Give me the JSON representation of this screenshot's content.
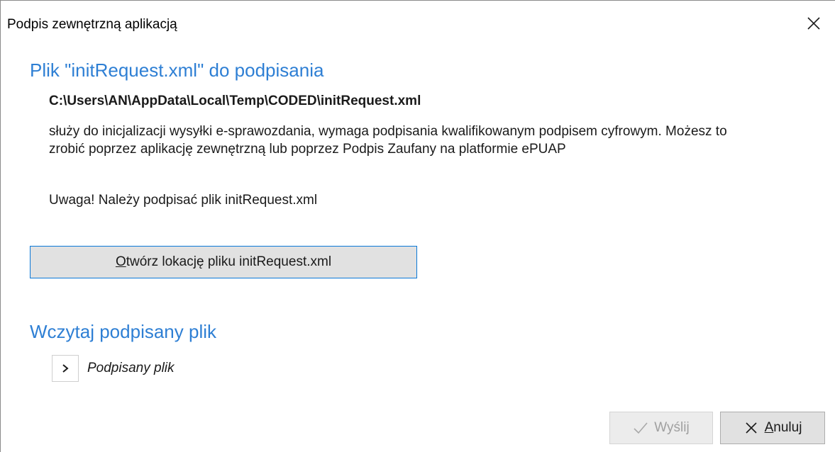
{
  "window": {
    "title": "Podpis zewnętrzną aplikacją"
  },
  "file_section": {
    "heading": "Plik \"initRequest.xml\" do podpisania",
    "path": "C:\\Users\\AN\\AppData\\Local\\Temp\\CODED\\initRequest.xml",
    "description": "służy do inicjalizacji wysyłki e-sprawozdania, wymaga podpisania kwalifikowanym podpisem cyfrowym. Możesz to zrobić poprzez aplikację zewnętrzną lub poprzez Podpis Zaufany na platformie ePUAP",
    "warning": "Uwaga! Należy podpisać plik initRequest.xml",
    "open_button_mnemonic": "O",
    "open_button_rest": "twórz lokację pliku initRequest.xml"
  },
  "load_section": {
    "heading": "Wczytaj podpisany plik",
    "expander_label": "Podpisany plik"
  },
  "footer": {
    "send_label": "Wyślij",
    "cancel_label": "Anuluj"
  },
  "icons": {
    "close": "close-icon",
    "expander": "chevron-right-icon",
    "send": "checkmark-icon",
    "cancel": "x-icon"
  },
  "colors": {
    "heading": "#2e7fd4",
    "focus_border": "#0a78d7",
    "disabled_text": "#a0a0a0"
  }
}
